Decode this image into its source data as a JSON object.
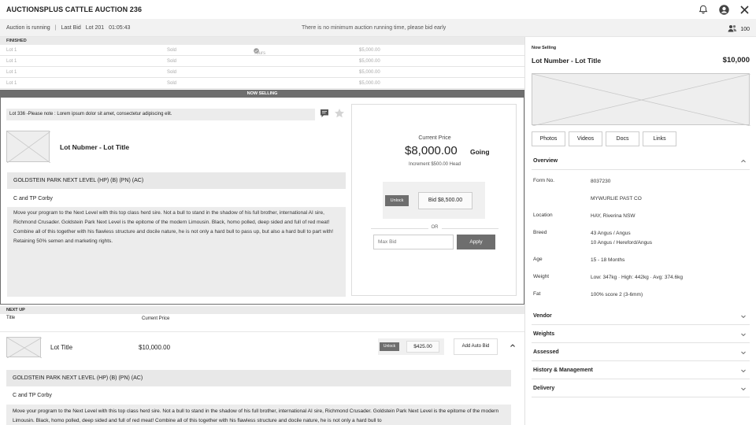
{
  "app": {
    "title": "AUCTIONSPLUS CATTLE AUCTION 236"
  },
  "status": {
    "running": "Auction is running",
    "last_bid_label": "Last Bid",
    "last_bid_value": "Lot 201",
    "last_bid_time": "01:05:43",
    "notice": "There is no minimum auction running time, please bid early",
    "viewers": "100"
  },
  "finished": {
    "label": "FINISHED",
    "rows": [
      {
        "lot": "Lot 1",
        "status": "Sold",
        "yours": "Yours",
        "price": "$5,000.00"
      },
      {
        "lot": "Lot 1",
        "status": "Sold",
        "yours": "",
        "price": "$5,000.00"
      },
      {
        "lot": "Lot 1",
        "status": "Sold",
        "yours": "",
        "price": "$5,000.00"
      },
      {
        "lot": "Lot 1",
        "status": "Sold",
        "yours": "",
        "price": "$5,000.00"
      }
    ]
  },
  "now_selling": {
    "bar_label": "NOW SELLING",
    "note": "Lot 336 -Please note : Lorem ipsum dolor sit amet, consectetur adipiscing elit.",
    "title": "Lot Nubmer - Lot Title",
    "subtitle": "GOLDSTEIN PARK NEXT LEVEL (HP) (B) (PN) (AC)",
    "vendor": "C and TP Corby",
    "description": "Move your program to the Next Level with this top class herd sire. Not a bull to stand in the shadow of his full brother, international AI sire, Richmond Crusader. Goldstein Park Next Level is the epitome of the modern Limousin. Black, homo polled, deep sided and full of red meat! Combine all of this together with his flawless structure and docile nature, he is not only a hard bull to pass up, but also a hard bull to part with! Retaining 50% semen and marketing rights.",
    "current_price_label": "Current Price",
    "current_price": "$8,000.00",
    "price_status": "Going",
    "increment": "Increment $500.00 Head",
    "unlock_label": "Unlock",
    "bid_label": "Bid $8,500.00",
    "or_label": "OR",
    "max_bid_placeholder": "Max Bid",
    "apply_label": "Apply"
  },
  "next_up": {
    "label": "NEXT UP",
    "col_title": "Title",
    "col_price": "Current Price",
    "item": {
      "title": "Lot Title",
      "price": "$10,000.00",
      "unlock_label": "Unlock",
      "bid_amount": "$425.00",
      "auto_bid_label": "Add Auto Bid",
      "subtitle": "GOLDSTEIN PARK NEXT LEVEL (HP) (B) (PN) (AC)",
      "vendor": "C and TP Corby",
      "description": "Move your program to the Next Level with this top class herd sire. Not a bull to stand in the shadow of his full brother, international AI sire, Richmond Crusader. Goldstein Park Next Level is the epitome of the modern Limousin. Black, homo polled, deep sided and full of red meat! Combine all of this together with his flawless structure and docile nature, he is not only a hard bull to"
    }
  },
  "side": {
    "label": "Now Selling",
    "title": "Lot Number - Lot Title",
    "price": "$10,000",
    "tabs": [
      "Photos",
      "Videos",
      "Docs",
      "Links"
    ],
    "overview": {
      "title": "Overview",
      "rows": [
        {
          "k": "Form No.",
          "v": "8037230"
        },
        {
          "k": "",
          "v": "MYWURLIE PAST CO"
        },
        {
          "k": "Location",
          "v": "HAY, Riverina NSW"
        },
        {
          "k": "Breed",
          "v": "43 Angus / Angus",
          "v2": "10 Angus / Hereford/Angus"
        },
        {
          "k": "Age",
          "v": "15 - 18 Months"
        },
        {
          "k": "Weight",
          "v": "Low: 347kg · High: 442kg · Avg: 374.6kg"
        },
        {
          "k": "Fat",
          "v": "100% score 2 (3-6mm)"
        }
      ]
    },
    "sections": [
      "Vendor",
      "Weights",
      "Assessed",
      "History & Management",
      "Delivery"
    ]
  }
}
